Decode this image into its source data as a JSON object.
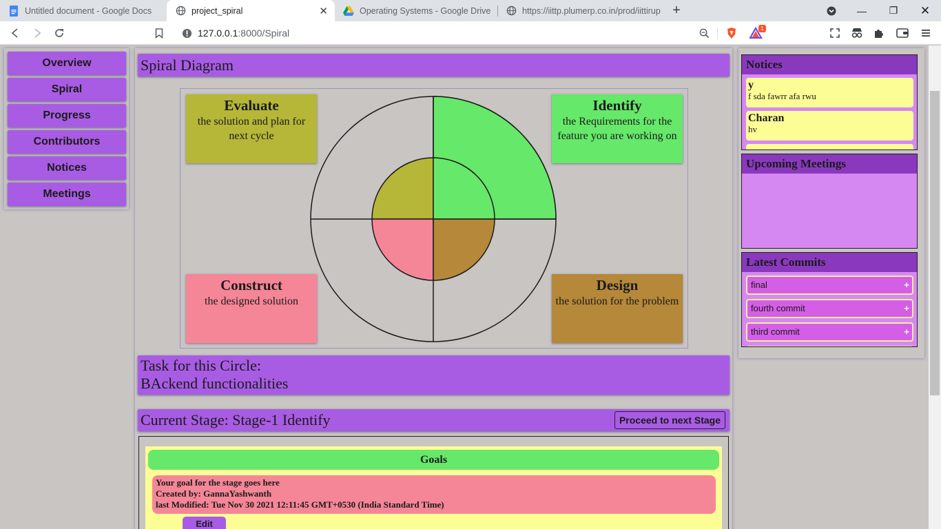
{
  "browser": {
    "tabs": [
      {
        "title": "Untitled document - Google Docs",
        "icon": "google-docs-icon"
      },
      {
        "title": "project_spiral",
        "icon": "globe-icon",
        "active": true
      },
      {
        "title": "Operating Systems - Google Drive",
        "icon": "google-drive-icon"
      },
      {
        "title": "https://iittp.plumerp.co.in/prod/iittirup",
        "icon": "globe-icon"
      }
    ],
    "url_host": "127.0.0.1",
    "url_path": ":8000/Spiral",
    "brave_badge": "1"
  },
  "nav": {
    "items": [
      "Overview",
      "Spiral",
      "Progress",
      "Contributors",
      "Notices",
      "Meetings"
    ]
  },
  "spiral": {
    "title": "Spiral Diagram",
    "colors": {
      "evaluate": "#b6b639",
      "identify": "#66e86a",
      "construct": "#f58697",
      "design": "#b5883a"
    },
    "quadrants": {
      "evaluate": {
        "title": "Evaluate",
        "desc": "the solution and plan for next cycle"
      },
      "identify": {
        "title": "Identify",
        "desc": "the Requirements for the feature you are working on"
      },
      "construct": {
        "title": "Construct",
        "desc": "the designed solution"
      },
      "design": {
        "title": "Design",
        "desc": "the solution for the problem"
      }
    }
  },
  "task": {
    "label": "Task for this Circle:",
    "value": "BAckend functionalities"
  },
  "stage": {
    "label": "Current Stage: Stage-1 Identify",
    "proceed_label": "Proceed to next Stage"
  },
  "goals": {
    "title": "Goals",
    "card": {
      "line1": "Your goal for the stage goes here",
      "line2": "Created by: GannaYashwanth",
      "line3": "last Modified: Tue Nov 30 2021 12:11:45 GMT+0530 (India Standard Time)"
    },
    "edit_label": "Edit"
  },
  "notices": {
    "title": "Notices",
    "items": [
      {
        "title": "y",
        "body": "f sda fawrr afa rwu"
      },
      {
        "title": "Charan",
        "body": "hv"
      }
    ]
  },
  "meetings": {
    "title": "Upcoming Meetings"
  },
  "commits": {
    "title": "Latest Commits",
    "items": [
      "final",
      "fourth commit",
      "third commit"
    ],
    "expand_symbol": "+"
  }
}
